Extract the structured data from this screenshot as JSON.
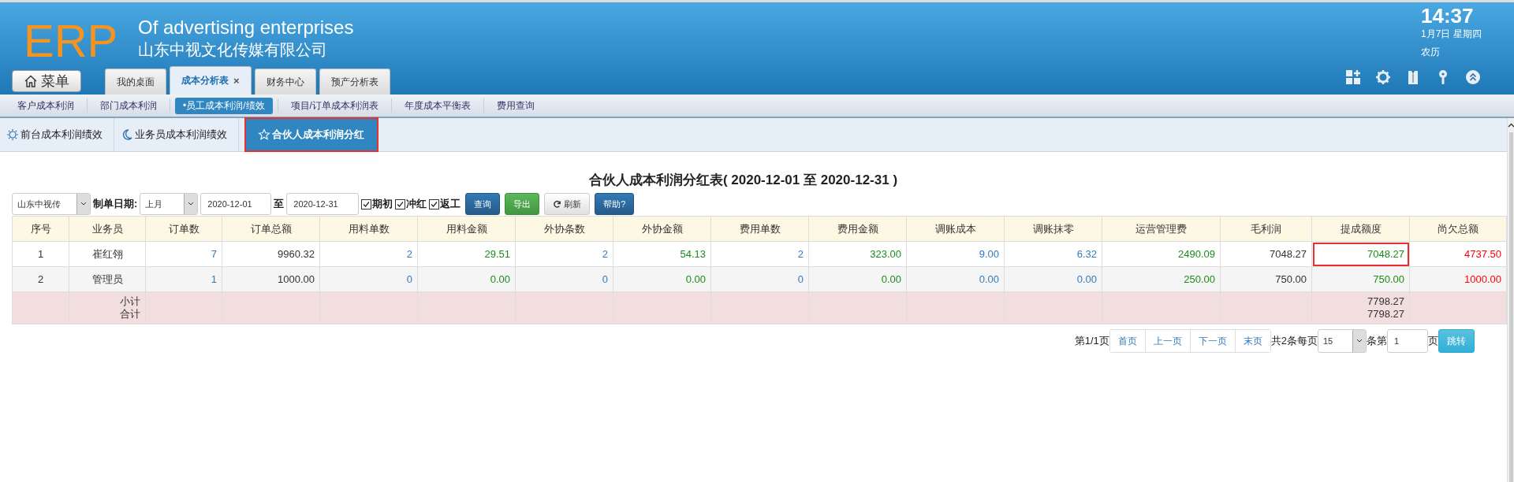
{
  "header": {
    "logo": "ERP",
    "title": "Of advertising enterprises",
    "company": "山东中视文化传媒有限公司",
    "menu_button": "菜单",
    "clock": {
      "time": "14:37",
      "date": "1月7日 星期四",
      "lunar": "农历"
    }
  },
  "main_tabs": [
    {
      "label": "我的桌面",
      "selected": false,
      "closable": false
    },
    {
      "label": "成本分析表",
      "selected": true,
      "closable": true,
      "close": "×"
    },
    {
      "label": "财务中心",
      "selected": false,
      "closable": false
    },
    {
      "label": "预产分析表",
      "selected": false,
      "closable": false
    }
  ],
  "sub_nav": [
    {
      "label": "客户成本利润",
      "selected": false
    },
    {
      "label": "部门成本利润",
      "selected": false
    },
    {
      "label": "•员工成本利润/绩效",
      "selected": true
    },
    {
      "label": "项目/订单成本利润表",
      "selected": false
    },
    {
      "label": "年度成本平衡表",
      "selected": false
    },
    {
      "label": "费用查询",
      "selected": false
    }
  ],
  "report_tabs": [
    {
      "label": "前台成本利润绩效",
      "selected": false,
      "highlighted": false
    },
    {
      "label": "业务员成本利润绩效",
      "selected": false,
      "highlighted": false
    },
    {
      "label": "合伙人成本利润分红",
      "selected": true,
      "highlighted": true
    }
  ],
  "report_title": "合伙人成本利润分红表( 2020-12-01 至 2020-12-31 )",
  "filters": {
    "company": "山东中视传",
    "date_label": "制单日期:",
    "period": "上月",
    "start_date": "2020-12-01",
    "to": "至",
    "end_date": "2020-12-31",
    "checkboxes": [
      {
        "label": "期初",
        "checked": true
      },
      {
        "label": "冲红",
        "checked": true
      },
      {
        "label": "返工",
        "checked": true
      }
    ],
    "buttons": [
      {
        "label": "查询",
        "kind": "primary"
      },
      {
        "label": "导出",
        "kind": "success"
      },
      {
        "label": "刷新",
        "kind": "refresh"
      },
      {
        "label": "帮助?",
        "kind": "primary"
      }
    ]
  },
  "table": {
    "columns": [
      {
        "label": "序号",
        "kind": "index"
      },
      {
        "label": "业务员",
        "kind": "name"
      },
      {
        "label": "订单数",
        "kind": "count"
      },
      {
        "label": "订单总额",
        "kind": "amount"
      },
      {
        "label": "用料单数",
        "kind": "count"
      },
      {
        "label": "用料金额",
        "kind": "income"
      },
      {
        "label": "外协条数",
        "kind": "count"
      },
      {
        "label": "外协金额",
        "kind": "income"
      },
      {
        "label": "费用单数",
        "kind": "count"
      },
      {
        "label": "费用金额",
        "kind": "income"
      },
      {
        "label": "调账成本",
        "kind": "count"
      },
      {
        "label": "调账抹零",
        "kind": "count"
      },
      {
        "label": "运营管理费",
        "kind": "income"
      },
      {
        "label": "毛利润",
        "kind": "amount"
      },
      {
        "label": "提成额度",
        "kind": "income"
      },
      {
        "label": "尚欠总额",
        "kind": "debt"
      }
    ],
    "rows": [
      {
        "cells": [
          {
            "text": "1",
            "highlighted": false
          },
          {
            "text": "崔红翎",
            "highlighted": false
          },
          {
            "text": "7",
            "highlighted": false
          },
          {
            "text": "9960.32",
            "highlighted": false
          },
          {
            "text": "2",
            "highlighted": false
          },
          {
            "text": "29.51",
            "highlighted": false
          },
          {
            "text": "2",
            "highlighted": false
          },
          {
            "text": "54.13",
            "highlighted": false
          },
          {
            "text": "2",
            "highlighted": false
          },
          {
            "text": "323.00",
            "highlighted": false
          },
          {
            "text": "9.00",
            "highlighted": false
          },
          {
            "text": "6.32",
            "highlighted": false
          },
          {
            "text": "2490.09",
            "highlighted": false
          },
          {
            "text": "7048.27",
            "highlighted": false
          },
          {
            "text": "7048.27",
            "highlighted": true
          },
          {
            "text": "4737.50",
            "highlighted": false
          }
        ]
      },
      {
        "cells": [
          {
            "text": "2",
            "highlighted": false
          },
          {
            "text": "管理员",
            "highlighted": false
          },
          {
            "text": "1",
            "highlighted": false
          },
          {
            "text": "1000.00",
            "highlighted": false
          },
          {
            "text": "0",
            "highlighted": false
          },
          {
            "text": "0.00",
            "highlighted": false
          },
          {
            "text": "0",
            "highlighted": false
          },
          {
            "text": "0.00",
            "highlighted": false
          },
          {
            "text": "0",
            "highlighted": false
          },
          {
            "text": "0.00",
            "highlighted": false
          },
          {
            "text": "0.00",
            "highlighted": false
          },
          {
            "text": "0.00",
            "highlighted": false
          },
          {
            "text": "250.00",
            "highlighted": false
          },
          {
            "text": "750.00",
            "highlighted": false
          },
          {
            "text": "750.00",
            "highlighted": false
          },
          {
            "text": "1000.00",
            "highlighted": false
          }
        ]
      }
    ],
    "totals": {
      "labels": [
        "小计",
        "合计"
      ],
      "values": [
        "7798.27",
        "7798.27"
      ]
    }
  },
  "pagination": {
    "page_info": "第1/1页",
    "buttons": [
      "首页",
      "上一页",
      "下一页",
      "末页"
    ],
    "count_text": "共2条每页",
    "page_size": "15",
    "goto_prefix": "条第",
    "page_input": "1",
    "goto_suffix": "页",
    "goto_button": "跳转"
  }
}
